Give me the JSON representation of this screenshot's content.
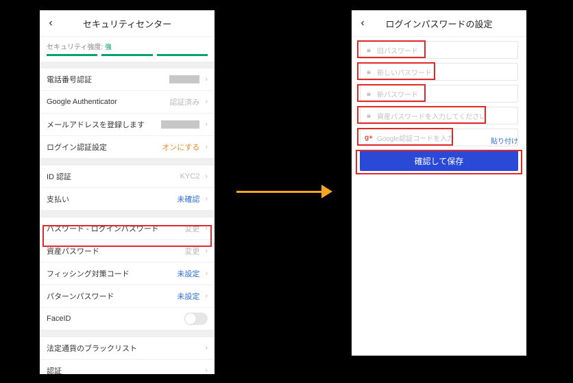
{
  "left": {
    "title": "セキュリティセンター",
    "strength_label": "セキュリティ強度:",
    "strength_value": "強",
    "rows": {
      "phone": {
        "label": "電話番号認証",
        "value": ""
      },
      "ga": {
        "label": "Google Authenticator",
        "value": "認証済み"
      },
      "email": {
        "label": "メールアドレスを登録します",
        "value": ""
      },
      "login": {
        "label": "ログイン認証設定",
        "value": "オンにする"
      },
      "id": {
        "label": "ID 認証",
        "value": "KYC2"
      },
      "pay": {
        "label": "支払い",
        "value": "未確認"
      },
      "loginpw": {
        "label": "パスワード - ログインパスワード",
        "value": "変更"
      },
      "assetpw": {
        "label": "資産パスワード",
        "value": "変更"
      },
      "phish": {
        "label": "フィッシング対策コード",
        "value": "未設定"
      },
      "pattern": {
        "label": "パターンパスワード",
        "value": "未設定"
      },
      "faceid": {
        "label": "FaceID",
        "value": ""
      },
      "blacklist": {
        "label": "法定通貨のブラックリスト",
        "value": ""
      },
      "cert": {
        "label": "認証",
        "value": ""
      }
    }
  },
  "right": {
    "title": "ログインパスワードの設定",
    "fields": {
      "old": {
        "placeholder": "旧パスワード"
      },
      "new": {
        "placeholder": "新しいパスワード"
      },
      "again": {
        "placeholder": "新パスワード"
      },
      "asset": {
        "placeholder": "資産パスワードを入力してください"
      },
      "ga": {
        "placeholder": "Google認証コードを入力"
      }
    },
    "paste": "貼り付け",
    "submit": "確認して保存"
  }
}
